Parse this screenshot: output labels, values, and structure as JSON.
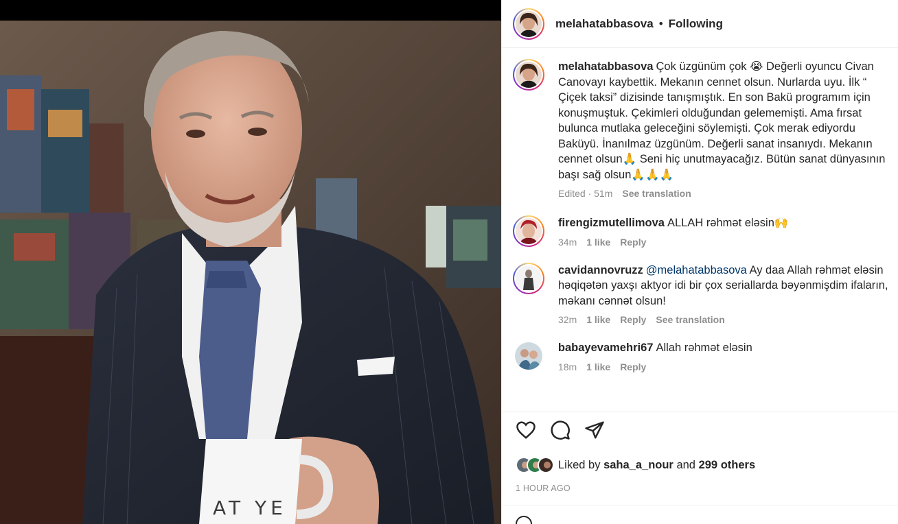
{
  "post": {
    "author": "melahatabbasova",
    "separator": "•",
    "follow_status": "Following",
    "caption": "Çok üzgünüm çok 😭 Değerli oyuncu Civan Canovayı kaybettik. Mekanın cennet olsun. Nurlarda uyu. İlk “ Çiçek taksi” dizisinde tanışmıştık. En son Bakü programım için konuşmuştuk. Çekimleri olduğundan gelememişti. Ama fırsat bulunca mutlaka geleceğini söylemişti. Çok merak ediyordu Baküyü. İnanılmaz üzgünüm. Değerli sanat insanıydı. Mekanın cennet olsun🙏 Seni hiç unutmayacağız. Bütün sanat dünyasının başı sağ olsun🙏🙏🙏",
    "caption_meta": "Edited · 51m",
    "see_translation": "See translation",
    "mug_text": "AT YE",
    "photo_icon": "portrait-photo"
  },
  "comments": [
    {
      "username": "firengizmutellimova",
      "text": "ALLAH rəhmət eləsin🙌",
      "age": "34m",
      "likes": "1 like",
      "reply": "Reply"
    },
    {
      "username": "cavidannovruzz",
      "mention": "@melahatabbasova",
      "text": "Ay daa Allah rəhmət eləsin həqiqətən yaxşı aktyor idi bir çox seriallarda bəyənmişdim ifaların, məkanı cənnət olsun!",
      "age": "32m",
      "likes": "1 like",
      "reply": "Reply",
      "see_translation": "See translation"
    },
    {
      "username": "babayevamehri67",
      "text": "Allah rəhmət eləsin",
      "age": "18m",
      "likes": "1 like",
      "reply": "Reply"
    }
  ],
  "actions": {
    "like_icon": "heart-icon",
    "comment_icon": "comment-icon",
    "share_icon": "share-icon"
  },
  "likes": {
    "prefix": "Liked by",
    "user": "saha_a_nour",
    "and": "and",
    "others": "299 others"
  },
  "timestamp": "1 HOUR AGO",
  "colors": {
    "text": "#262626",
    "muted": "#8e8e8e",
    "mention": "#00376b",
    "border": "#efefef"
  }
}
